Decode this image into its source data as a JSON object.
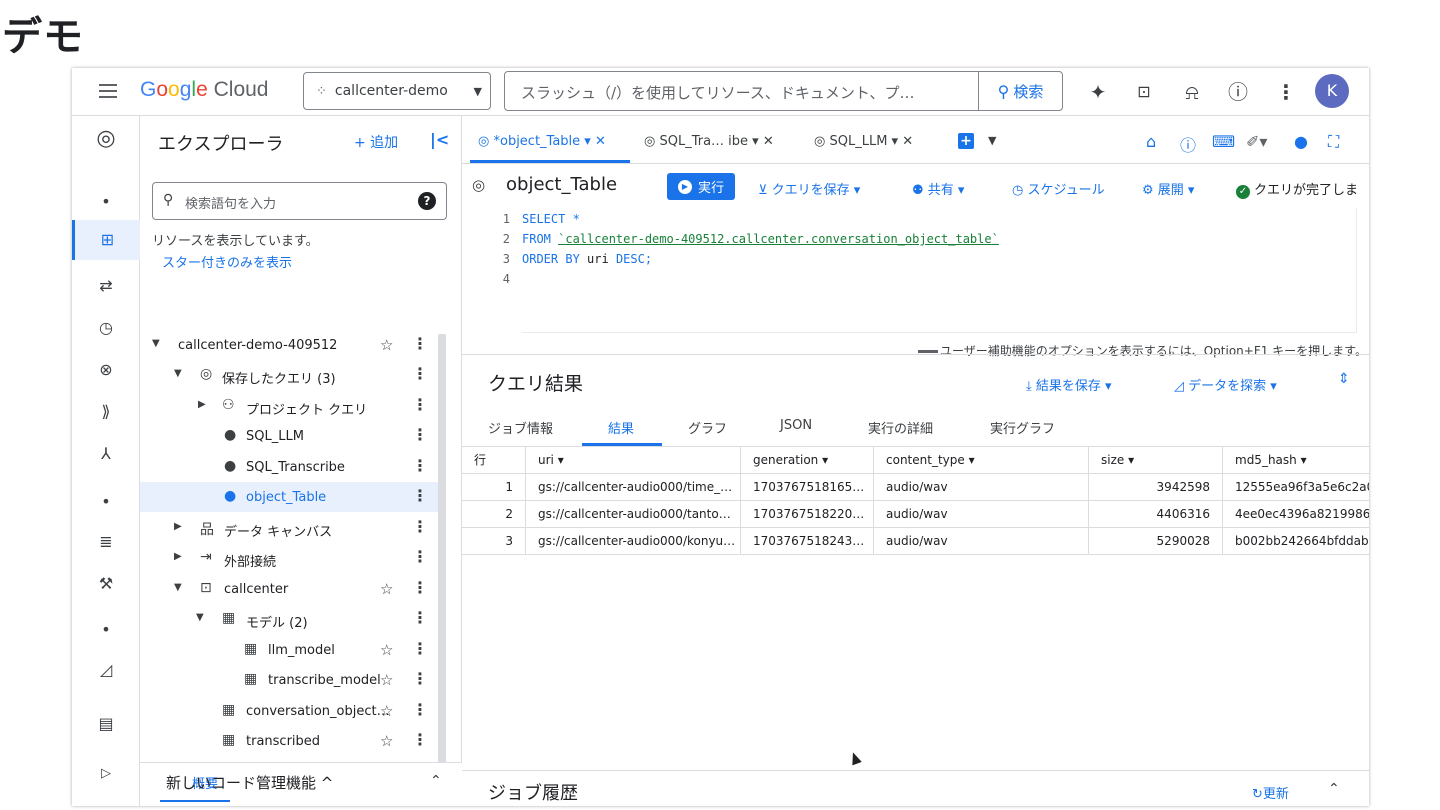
{
  "slide_title": "デモ",
  "topbar": {
    "logo_google": [
      "G",
      "o",
      "o",
      "g",
      "l",
      "e"
    ],
    "logo_cloud": "Cloud",
    "project": "callcenter-demo",
    "search_placeholder": "スラッシュ（/）を使用してリソース、ドキュメント、プ…",
    "search_button": "検索",
    "avatar_letter": "K",
    "icons": [
      "gemini-icon",
      "terminal-icon",
      "bell-icon",
      "help-icon",
      "more-vert-icon"
    ]
  },
  "explorer": {
    "title": "エクスプローラ",
    "add_label": "+ 追加",
    "search_placeholder": "検索語句を入力",
    "info_text": "リソースを表示しています。",
    "starred_link": "スター付きのみを表示",
    "tree": [
      {
        "label": "callcenter-demo-409512"
      },
      {
        "label": "保存したクエリ (3)"
      },
      {
        "label": "プロジェクト クエリ"
      },
      {
        "label": "SQL_LLM"
      },
      {
        "label": "SQL_Transcribe"
      },
      {
        "label": "object_Table"
      },
      {
        "label": "データ キャンバス"
      },
      {
        "label": "外部接続"
      },
      {
        "label": "callcenter"
      },
      {
        "label": "モデル (2)"
      },
      {
        "label": "llm_model"
      },
      {
        "label": "transcribe_model"
      },
      {
        "label": "conversation_object…"
      },
      {
        "label": "transcribed"
      }
    ],
    "bottom_tab": "概要",
    "new_code": "新しいコード管理機能 ^"
  },
  "tabs": [
    {
      "label": "*object_Table ▾ ✕"
    },
    {
      "label": "SQL_Tra… ibe ▾ ✕"
    },
    {
      "label": "SQL_LLM ▾ ✕"
    }
  ],
  "query": {
    "title": "object_Table",
    "run": "実行",
    "save": "クエリを保存 ▾",
    "share": "共有 ▾",
    "schedule": "スケジュール",
    "deploy": "展開 ▾",
    "status": "クエリが完了しま",
    "lines": [
      "1",
      "2",
      "3",
      "4"
    ],
    "code_l1_kw": "SELECT *",
    "code_l2_kw": "FROM ",
    "code_l2_str": "`callcenter-demo-409512.callcenter.conversation_object_table`",
    "code_l3_kw1": "ORDER BY ",
    "code_l3_plain": "uri",
    "code_l3_kw2": " DESC;",
    "a11y_hint": "ユーザー補助機能のオプションを表示するには、Option+F1 キーを押します。"
  },
  "results": {
    "title": "クエリ結果",
    "save": "結果を保存 ▾",
    "explore": "データを探索 ▾",
    "tabs": [
      "ジョブ情報",
      "結果",
      "グラフ",
      "JSON",
      "実行の詳細",
      "実行グラフ"
    ],
    "columns": [
      "行",
      "uri ▾",
      "generation ▾",
      "content_type ▾",
      "size ▾",
      "md5_hash ▾"
    ],
    "rows": [
      [
        "1",
        "gs://callcenter-audio000/time_…",
        "1703767518165…",
        "audio/wav",
        "3942598",
        "12555ea96f3a5e6c2a0"
      ],
      [
        "2",
        "gs://callcenter-audio000/tanto…",
        "1703767518220…",
        "audio/wav",
        "4406316",
        "4ee0ec4396a8219986c"
      ],
      [
        "3",
        "gs://callcenter-audio000/konyu…",
        "1703767518243…",
        "audio/wav",
        "5290028",
        "b002bb242664bfddab9"
      ]
    ]
  },
  "history": {
    "title": "ジョブ履歴",
    "refresh": "更新"
  },
  "colors": {
    "accent": "#1a73e8",
    "success": "#188038",
    "avatar": "#5c6bc0"
  }
}
